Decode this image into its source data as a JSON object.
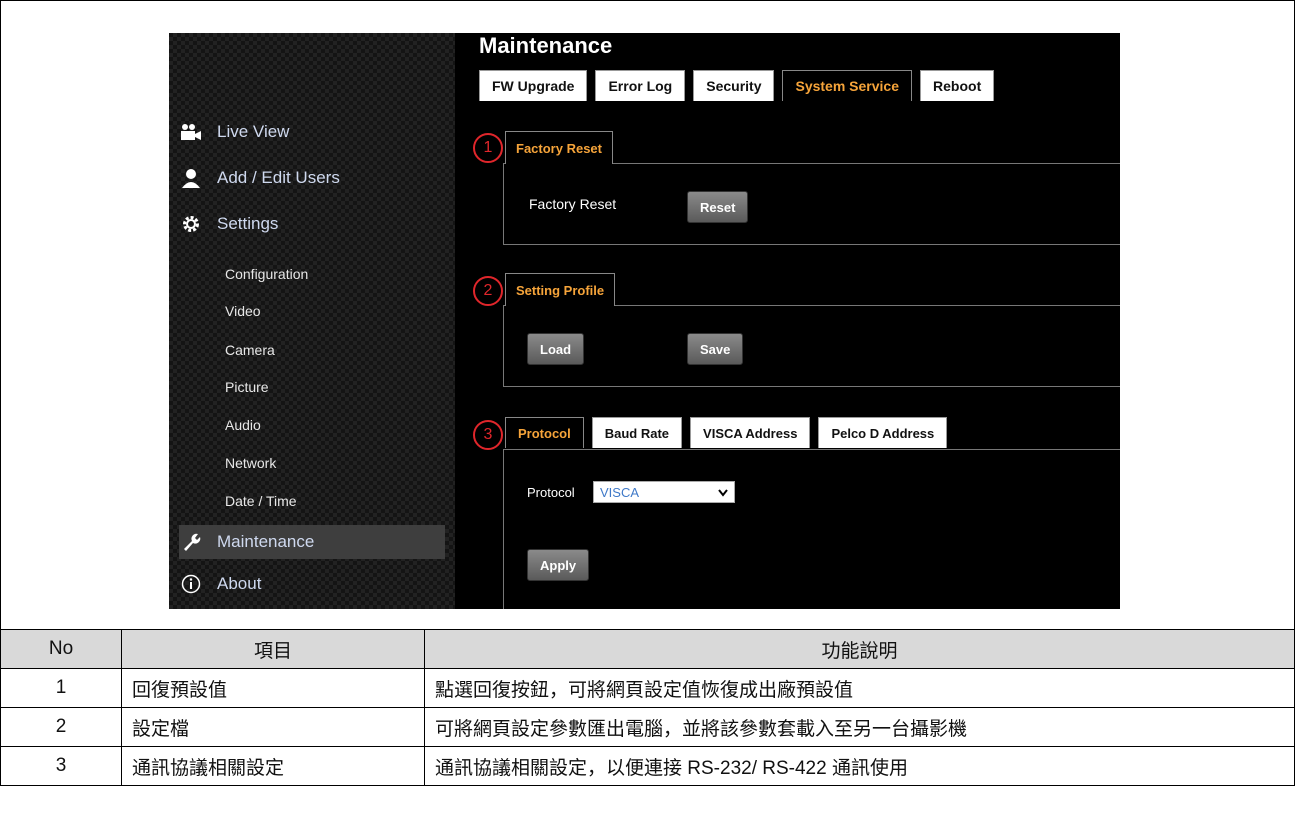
{
  "sidebar": {
    "main_items": [
      {
        "label": "Live View",
        "icon": "video-camera-icon"
      },
      {
        "label": "Add / Edit Users",
        "icon": "user-icon"
      },
      {
        "label": "Settings",
        "icon": "gear-icon"
      }
    ],
    "sub_items": [
      "Configuration",
      "Video",
      "Camera",
      "Picture",
      "Audio",
      "Network",
      "Date / Time"
    ],
    "maintenance": {
      "label": "Maintenance",
      "icon": "wrench-icon",
      "active": true
    },
    "about": {
      "label": "About",
      "icon": "info-icon"
    }
  },
  "main": {
    "title": "Maintenance",
    "tabs": [
      "FW Upgrade",
      "Error Log",
      "Security",
      "System Service",
      "Reboot"
    ],
    "active_tab": "System Service",
    "factory_reset": {
      "marker": "1",
      "tab": "Factory Reset",
      "label": "Factory Reset",
      "reset_button": "Reset"
    },
    "setting_profile": {
      "marker": "2",
      "tab": "Setting Profile",
      "load_button": "Load",
      "save_button": "Save"
    },
    "protocol_section": {
      "marker": "3",
      "tabs": [
        "Protocol",
        "Baud Rate",
        "VISCA Address",
        "Pelco D Address"
      ],
      "active_tab": "Protocol",
      "label": "Protocol",
      "selected": "VISCA",
      "apply_button": "Apply"
    }
  },
  "table": {
    "headers": [
      "No",
      "項目",
      "功能說明"
    ],
    "rows": [
      [
        "1",
        "回復預設值",
        "點選回復按鈕，可將網頁設定值恢復成出廠預設值"
      ],
      [
        "2",
        "設定檔",
        "可將網頁設定參數匯出電腦，並將該參數套載入至另一台攝影機"
      ],
      [
        "3",
        "通訊協議相關設定",
        "通訊協議相關設定，以便連接 RS-232/ RS-422 通訊使用"
      ]
    ]
  },
  "colors": {
    "accent_orange": "#f6a43a",
    "marker_red": "#e0262b",
    "header_gray": "#d9d9d9"
  }
}
